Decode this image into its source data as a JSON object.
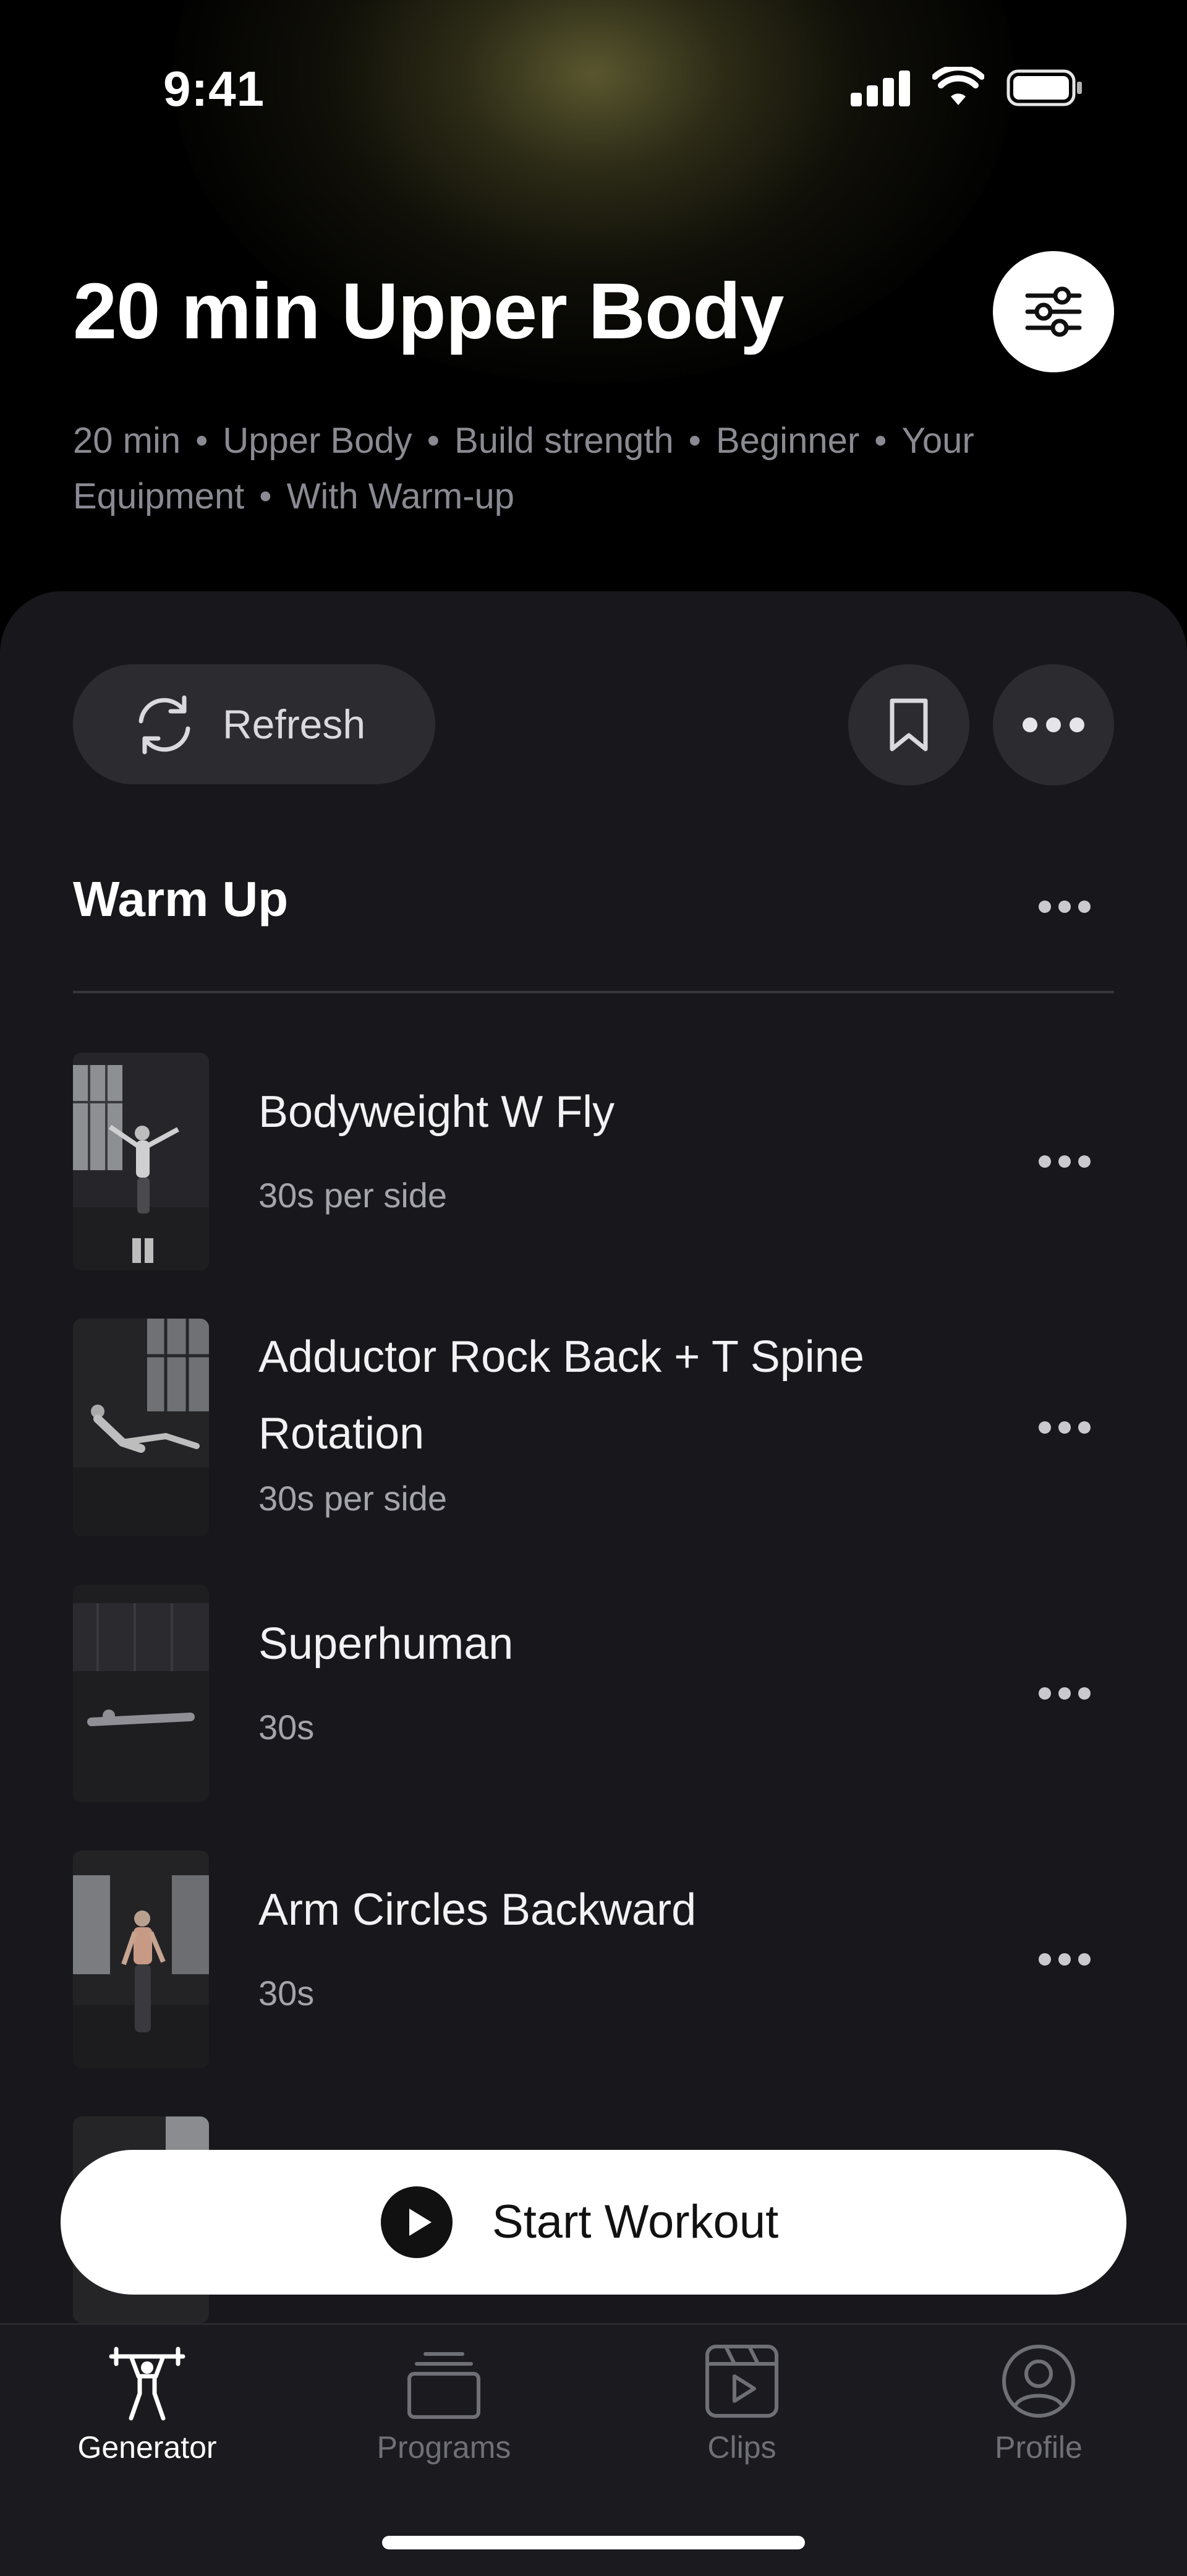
{
  "status_bar": {
    "time": "9:41"
  },
  "header": {
    "title": "20 min Upper Body",
    "meta": [
      "20 min",
      "Upper Body",
      "Build strength",
      "Beginner",
      "Your Equipment",
      "With Warm-up"
    ]
  },
  "actions": {
    "refresh_label": "Refresh"
  },
  "section": {
    "title": "Warm Up"
  },
  "exercises": [
    {
      "name": "Bodyweight W Fly",
      "detail": "30s per side"
    },
    {
      "name": "Adductor Rock Back + T Spine Rotation",
      "detail": "30s per side"
    },
    {
      "name": "Superhuman",
      "detail": "30s"
    },
    {
      "name": "Arm Circles Backward",
      "detail": "30s"
    }
  ],
  "cta": {
    "label": "Start Workout"
  },
  "tabs": [
    {
      "label": "Generator",
      "icon": "weightlifter-icon",
      "active": true
    },
    {
      "label": "Programs",
      "icon": "stack-icon",
      "active": false
    },
    {
      "label": "Clips",
      "icon": "clips-play-icon",
      "active": false
    },
    {
      "label": "Profile",
      "icon": "profile-icon",
      "active": false
    }
  ]
}
